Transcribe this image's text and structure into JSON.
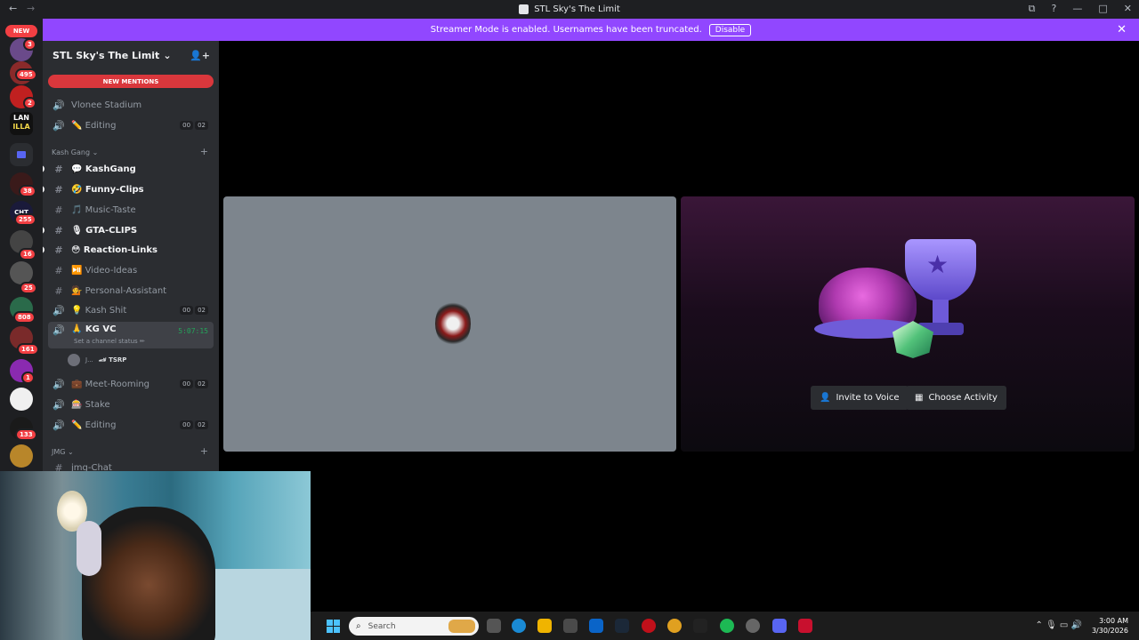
{
  "window": {
    "title": "STL Sky's The Limit",
    "back_glyph": "←",
    "fwd_glyph": "→",
    "controls": [
      "⧉",
      "?",
      "—",
      "□",
      "✕"
    ]
  },
  "banner": {
    "text": "Streamer Mode is enabled. Usernames have been truncated.",
    "button": "Disable",
    "close": "✕"
  },
  "rail": {
    "new_label": "NEW",
    "badges": [
      "3",
      "495",
      "2",
      "38",
      "255",
      "16",
      "25",
      "808",
      "161",
      "1",
      "133"
    ],
    "lan_line1": "LAN",
    "lan_line2": "ILLA",
    "cht_label": "CHT"
  },
  "sidebar": {
    "server_name": "STL Sky's The Limit",
    "chevron": "⌄",
    "invite_icon": "👤+",
    "new_mentions": "NEW MENTIONS",
    "speaker_icon": "🔊",
    "hash_icon": "#",
    "add_icon": "+",
    "top_channels": [
      {
        "name": "Vlonee Stadium"
      },
      {
        "name": "✏️ Editing",
        "c1": "00",
        "c2": "02"
      }
    ],
    "category1": "Kash Gang ⌄",
    "text_channels": [
      {
        "name": "💬 KashGang"
      },
      {
        "name": "🤣 Funny-Clips"
      },
      {
        "name": "🎵 Music-Taste"
      },
      {
        "name": "🎙 GTA-CLIPS"
      },
      {
        "name": "😳 Reaction-Links"
      },
      {
        "name": "⏯️ Video-Ideas"
      },
      {
        "name": "💁 Personal-Assistant"
      }
    ],
    "kash_shit": {
      "name": "💡 Kash Shit",
      "c1": "00",
      "c2": "02"
    },
    "kg_vc": {
      "name": "🙏 KG VC",
      "timer": "5:07:15",
      "status": "Set a channel status ✏"
    },
    "member": {
      "name": "J...",
      "tag": "🏎 TSRP"
    },
    "more_channels": [
      {
        "name": "💼 Meet-Rooming",
        "c1": "00",
        "c2": "02"
      },
      {
        "name": "🎰 Stake"
      },
      {
        "name": "✏️ Editing",
        "c1": "00",
        "c2": "02"
      }
    ],
    "category2": "JMG ⌄",
    "partial_channel": "jmg-Chat"
  },
  "activity": {
    "invite_button": "Invite to Voice",
    "invite_icon": "👤",
    "choose_button": "Choose Activity",
    "choose_icon": "▦",
    "star": "★"
  },
  "taskbar": {
    "search_placeholder": "Search",
    "search_icon": "⌕",
    "tray": "⌃  🎙  ▭  🔊",
    "time": "3:00 AM",
    "date": "3/30/2026"
  }
}
